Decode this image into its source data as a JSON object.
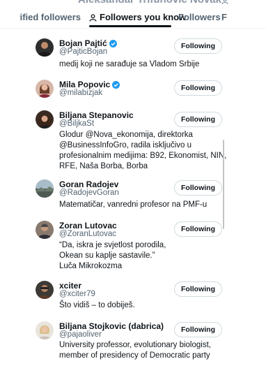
{
  "header": {
    "title": "Aleksandar Trifunovic Novak"
  },
  "tabs": [
    {
      "label": "Verified followers"
    },
    {
      "label": "Followers you know"
    },
    {
      "label": "Followers"
    },
    {
      "label": "F"
    }
  ],
  "users": [
    {
      "name": "Bojan Pajtić",
      "verified": true,
      "handle": "@PajticBojan",
      "bio": [
        "medij koji ne sarađuje sa Vladom Srbije"
      ],
      "button": "Following"
    },
    {
      "name": "Mila Popovic",
      "verified": true,
      "handle": "@milabizjak",
      "bio": [],
      "button": "Following"
    },
    {
      "name": "Biljana Stepanovic",
      "verified": false,
      "handle": "@BiljkaSt",
      "bio": [
        "Glodur @Nova_ekonomija, direktorka",
        "@BusinessInfoGro, radila isključivo u",
        "profesionalnim medijima: B92, Ekonomist, NIN,",
        "RFE, Naša Borba, Borba"
      ],
      "button": "Following"
    },
    {
      "name": "Goran Radojev",
      "verified": false,
      "handle": "@RadojevGoran",
      "bio": [
        "Matematičar, vanredni profesor na PMF-u"
      ],
      "button": "Following"
    },
    {
      "name": "Zoran Lutovac",
      "verified": false,
      "handle": "@ZoranLutovac",
      "bio": [
        "“Da, iskra je svjetlost porodila,",
        "Okean su kaplje sastavile.”",
        "Luča Mikrokozma"
      ],
      "button": "Following"
    },
    {
      "name": "xciter",
      "verified": false,
      "handle": "@xciter79",
      "bio": [
        "Što vidiš – to dobiješ."
      ],
      "button": "Following"
    },
    {
      "name": "Biljana Stojkovic (dabrica)",
      "verified": false,
      "handle": "@pajaoliver",
      "bio": [
        "University professor, evolutionary biologist,",
        "member of presidency of Democratic party"
      ],
      "button": "Following"
    }
  ],
  "colors": {
    "verified_badge": "#1d9bf0",
    "text_primary": "#0f1419",
    "text_secondary": "#536471",
    "border": "#cfd9de"
  }
}
